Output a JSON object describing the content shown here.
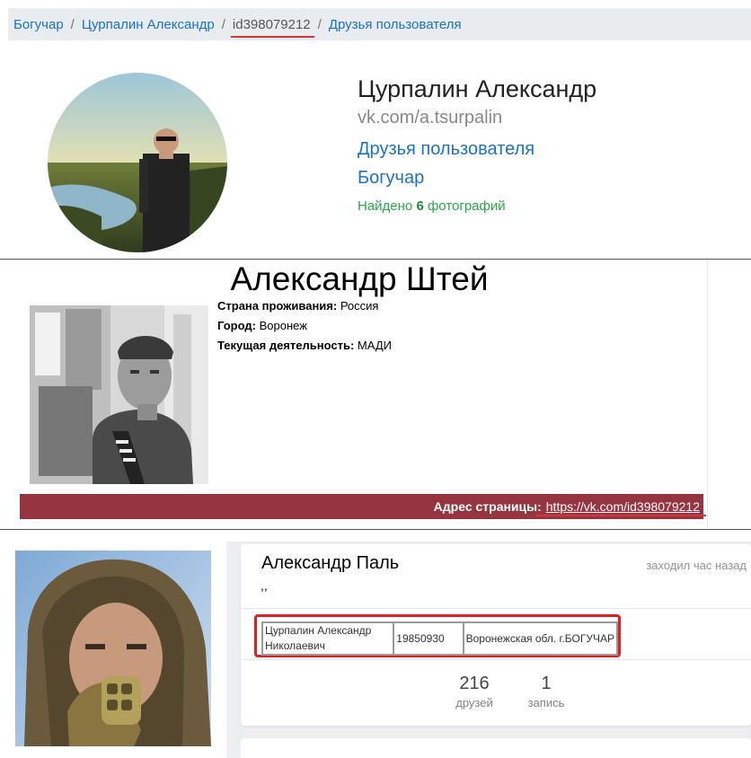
{
  "breadcrumb": {
    "items": [
      "Богучар",
      "Цурпалин Александр",
      "id398079212",
      "Друзья пользователя"
    ],
    "separator": "/"
  },
  "profile": {
    "name": "Цурпалин Александр",
    "url": "vk.com/a.tsurpalin",
    "friends_link": "Друзья пользователя",
    "city_link": "Богучар",
    "found_prefix": "Найдено",
    "found_count": "6",
    "found_suffix": "фотографий"
  },
  "old_profile": {
    "name": "Александр Штей",
    "fields": [
      {
        "label": "Страна проживания:",
        "value": "Россия"
      },
      {
        "label": "Город:",
        "value": "Воронеж"
      },
      {
        "label": "Текущая деятельность:",
        "value": "МАДИ"
      }
    ],
    "address_label": "Адрес страницы:",
    "address_url": "https://vk.com/id398079212"
  },
  "vk_card": {
    "name": "Александр Паль",
    "last_seen": "заходил час назад",
    "status": ",,",
    "table": {
      "name": "Цурпалин Александр Николаевич",
      "date": "19850930",
      "location": "Воронежская обл. г.БОГУЧАР"
    },
    "stats": [
      {
        "value": "216",
        "label": "друзей"
      },
      {
        "value": "1",
        "label": "запись"
      }
    ]
  },
  "colors": {
    "link": "#1a73c8",
    "found_green": "#28a745",
    "address_bar": "#963440",
    "highlight_red": "#e02020"
  }
}
